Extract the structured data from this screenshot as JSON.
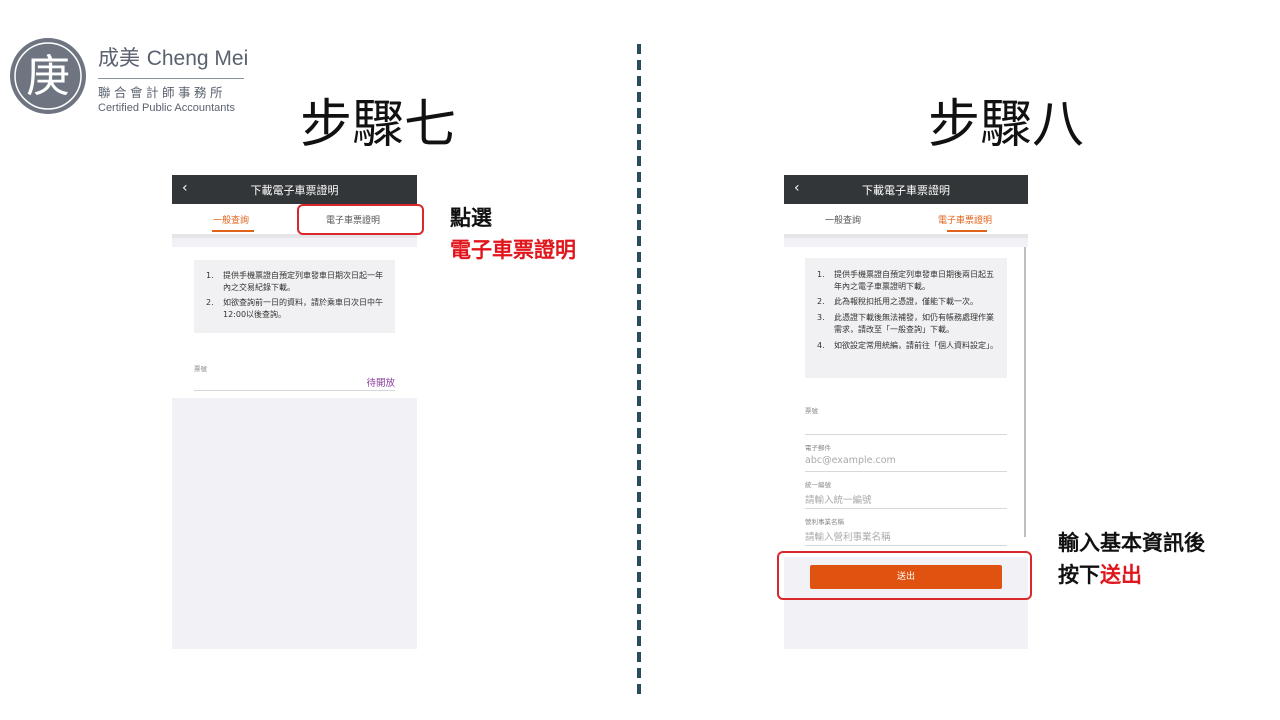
{
  "logo": {
    "emblem_char": "庚",
    "name_cn": "成美",
    "name_en": "Cheng Mei",
    "firm_cn": "聯合會計師事務所",
    "firm_en": "Certified Public Accountants"
  },
  "step7": {
    "title": "步驟七",
    "screen": {
      "back_icon": "‹",
      "title": "下載電子車票證明",
      "tabs": [
        "一般查詢",
        "電子車票證明"
      ],
      "active_tab": 0,
      "notices": [
        {
          "num": "1.",
          "text": "提供手機票證自預定列車發車日期次日起一年內之交易紀錄下載。"
        },
        {
          "num": "2.",
          "text": "如欲查詢前一日的資料，請於乘車日次日中午12:00以後查詢。"
        }
      ],
      "field_label": "票號",
      "field_status": "待開放"
    },
    "callout": {
      "line1": "點選",
      "line2": "電子車票證明"
    }
  },
  "step8": {
    "title": "步驟八",
    "screen": {
      "back_icon": "‹",
      "title": "下載電子車票證明",
      "tabs": [
        "一般查詢",
        "電子車票證明"
      ],
      "active_tab": 1,
      "notices": [
        {
          "num": "1.",
          "text": "提供手機票證自預定列車發車日期後兩日起五年內之電子車票證明下載。"
        },
        {
          "num": "2.",
          "text": "此為報稅扣抵用之憑證，僅能下載一次。"
        },
        {
          "num": "3.",
          "text": "此憑證下載後無法補發，如仍有帳務處理作業需求，請改至「一般查詢」下載。"
        },
        {
          "num": "4.",
          "text": "如欲設定常用統編，請前往「個人資料設定」。"
        }
      ],
      "fields": [
        {
          "label": "票號",
          "placeholder": ""
        },
        {
          "label": "電子郵件",
          "placeholder": "abc@example.com"
        },
        {
          "label": "統一編號",
          "placeholder": "請輸入統一編號"
        },
        {
          "label": "營利事業名稱",
          "placeholder": "請輸入營利事業名稱"
        }
      ],
      "submit_label": "送出"
    },
    "callout": {
      "line1": "輸入基本資訊後",
      "line2_prefix": "按下",
      "line2_highlight": "送出"
    }
  },
  "colors": {
    "accent": "#e0631c",
    "highlight": "#e0161c",
    "topbar": "#333638",
    "divider": "#2a4d5e"
  }
}
